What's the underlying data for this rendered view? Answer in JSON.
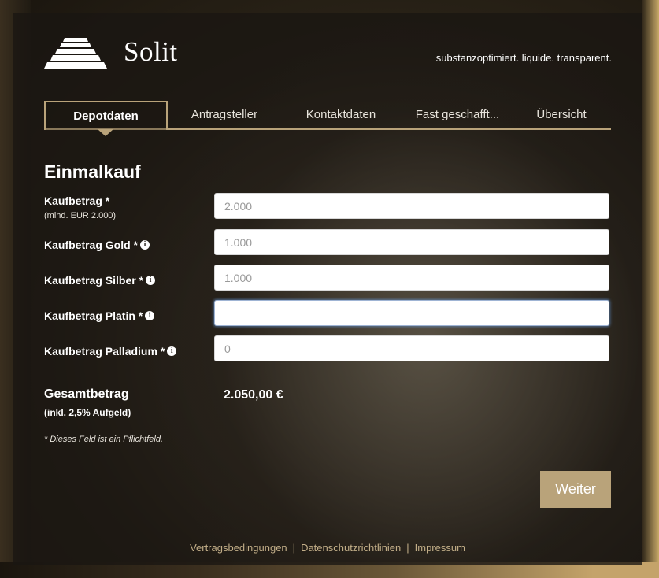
{
  "brand": {
    "name": "Solit",
    "tagline": "substanzoptimiert. liquide. transparent."
  },
  "tabs": [
    {
      "label": "Depotdaten",
      "active": true
    },
    {
      "label": "Antragsteller"
    },
    {
      "label": "Kontaktdaten"
    },
    {
      "label": "Fast geschafft..."
    },
    {
      "label": "Übersicht"
    }
  ],
  "form": {
    "heading": "Einmalkauf",
    "fields": [
      {
        "label": "Kaufbetrag *",
        "sublabel": "(mind. EUR 2.000)",
        "value": "",
        "placeholder": "2.000"
      },
      {
        "label": "Kaufbetrag Gold *",
        "value": "",
        "placeholder": "1.000",
        "icon": "info-icon"
      },
      {
        "label": "Kaufbetrag Silber *",
        "value": "",
        "placeholder": "1.000",
        "icon": "info-icon"
      },
      {
        "label": "Kaufbetrag Platin *",
        "value": "",
        "placeholder": "",
        "icon": "info-icon",
        "focused": true
      },
      {
        "label": "Kaufbetrag Palladium *",
        "value": "",
        "placeholder": "0",
        "icon": "info-icon"
      }
    ],
    "info_glyph": "i",
    "total": {
      "label": "Gesamtbetrag",
      "sublabel": "(inkl. 2,5% Aufgeld)",
      "value": "2.050,00 €"
    },
    "required_note": "* Dieses Feld ist ein Pflichtfeld.",
    "next_label": "Weiter"
  },
  "footer": {
    "links": [
      "Vertragsbedingungen",
      "Datenschutzrichtlinien",
      "Impressum"
    ],
    "separator": "|"
  },
  "colors": {
    "accent": "#b9a37a",
    "panel": "#1f1b16",
    "link": "#c2ae88",
    "focus": "#6699dc"
  }
}
